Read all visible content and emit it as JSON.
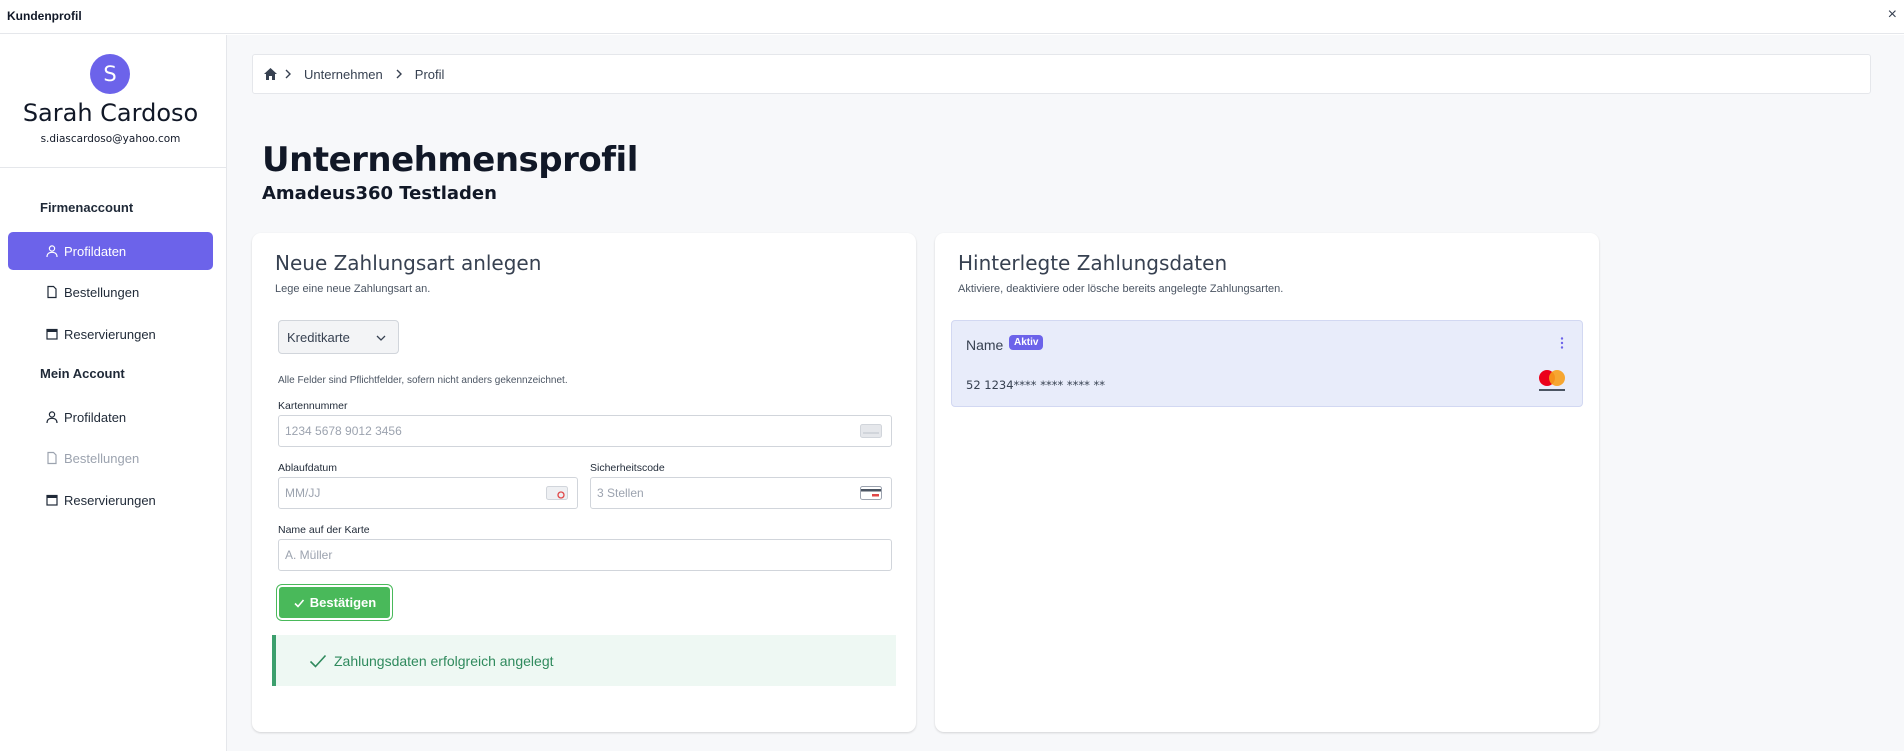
{
  "window": {
    "title": "Kundenprofil",
    "close_glyph": "×"
  },
  "user": {
    "initial": "S",
    "name": "Sarah Cardoso",
    "email": "s.diascardoso@yahoo.com"
  },
  "sidebar": {
    "sections": [
      {
        "title": "Firmenaccount",
        "items": [
          {
            "label": "Profildaten",
            "icon": "user-icon",
            "state": "active"
          },
          {
            "label": "Bestellungen",
            "icon": "file-icon",
            "state": "normal"
          },
          {
            "label": "Reservierungen",
            "icon": "calendar-icon",
            "state": "normal"
          }
        ]
      },
      {
        "title": "Mein Account",
        "items": [
          {
            "label": "Profildaten",
            "icon": "user-icon",
            "state": "normal"
          },
          {
            "label": "Bestellungen",
            "icon": "file-icon",
            "state": "disabled"
          },
          {
            "label": "Reservierungen",
            "icon": "calendar-icon",
            "state": "normal"
          }
        ]
      }
    ]
  },
  "breadcrumb": {
    "home_icon": "home-icon",
    "items": [
      "Unternehmen",
      "Profil"
    ]
  },
  "page": {
    "title": "Unternehmensprofil",
    "subtitle": "Amadeus360 Testladen"
  },
  "new_payment": {
    "title": "Neue Zahlungsart anlegen",
    "description": "Lege eine neue Zahlungsart an.",
    "type_selected": "Kreditkarte",
    "required_note": "Alle Felder sind Pflichtfelder, sofern nicht anders gekennzeichnet.",
    "card_number": {
      "label": "Kartennummer",
      "value": "",
      "placeholder": "1234 5678 9012 3456"
    },
    "expiry": {
      "label": "Ablaufdatum",
      "value": "",
      "placeholder": "MM/JJ"
    },
    "cvc": {
      "label": "Sicherheitscode",
      "value": "",
      "placeholder": "3 Stellen"
    },
    "card_name": {
      "label": "Name auf der Karte",
      "value": "",
      "placeholder": "A. Müller"
    },
    "confirm_label": "Bestätigen",
    "success_message": "Zahlungsdaten erfolgreich angelegt"
  },
  "saved_payments": {
    "title": "Hinterlegte Zahlungsdaten",
    "description": "Aktiviere, deaktiviere oder lösche bereits angelegte Zahlungsarten.",
    "cards": [
      {
        "name": "Name",
        "status": "Aktiv",
        "number": "52 1234**** **** **** **",
        "brand": "mastercard"
      }
    ]
  },
  "colors": {
    "accent": "#6c63ea",
    "success": "#49b95a",
    "success_text": "#2f8a5d"
  }
}
